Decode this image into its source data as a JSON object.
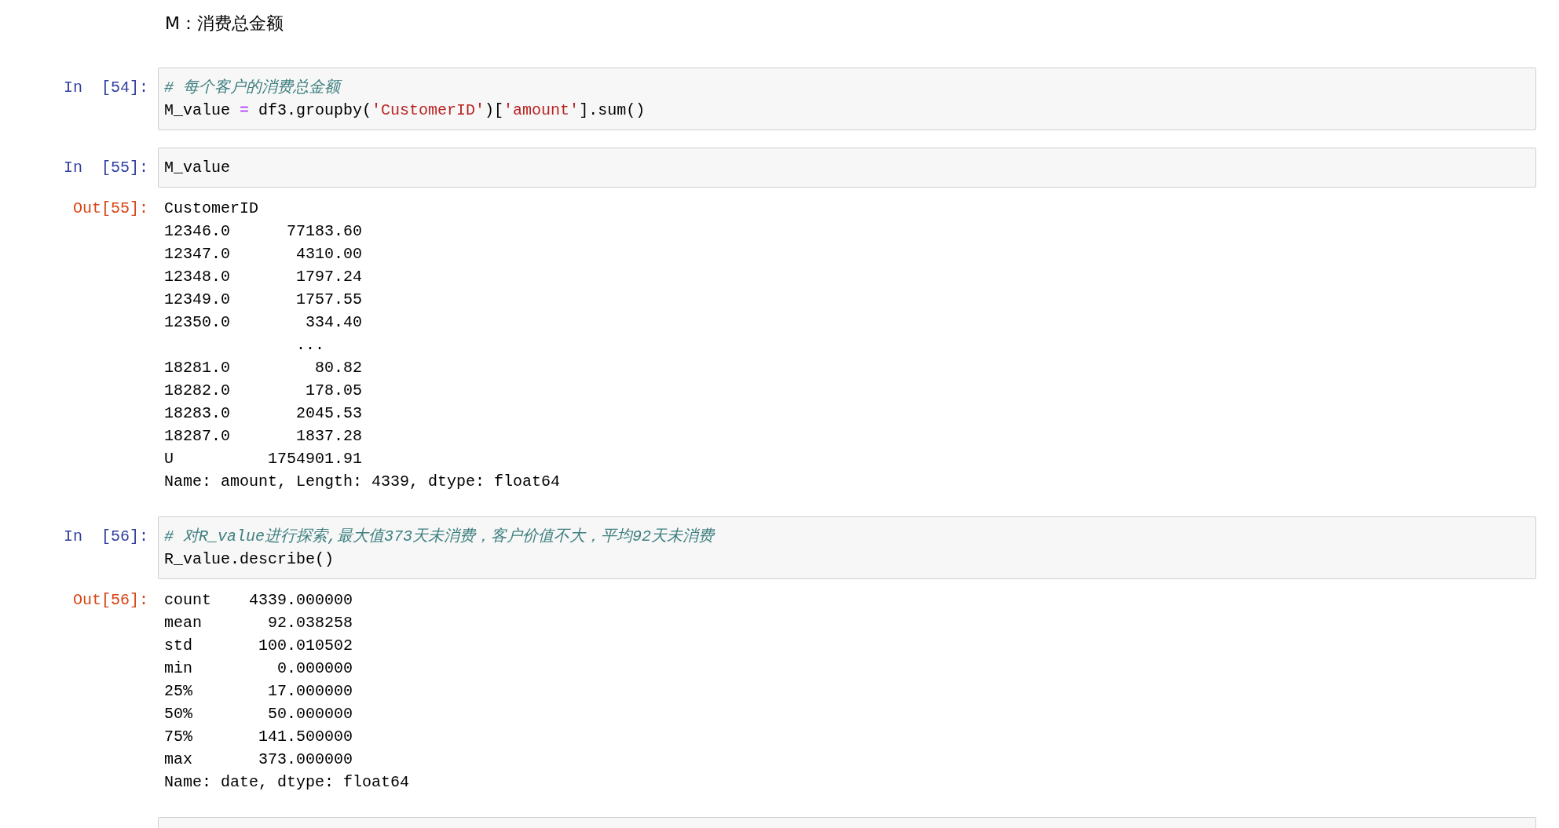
{
  "cells": [
    {
      "kind": "markdown",
      "text": "M：消费总金额"
    },
    {
      "kind": "code",
      "prompt": "In  [54]:",
      "source": [
        [
          {
            "kind": "comment",
            "text": "# 每个客户的消费总金额"
          }
        ],
        [
          {
            "kind": "plain",
            "text": "M_value "
          },
          {
            "kind": "operator",
            "text": "="
          },
          {
            "kind": "plain",
            "text": " df3.groupby("
          },
          {
            "kind": "string",
            "text": "'CustomerID'"
          },
          {
            "kind": "plain",
            "text": ")["
          },
          {
            "kind": "string",
            "text": "'amount'"
          },
          {
            "kind": "plain",
            "text": "].sum()"
          }
        ]
      ]
    },
    {
      "kind": "code",
      "prompt": "In  [55]:",
      "source": [
        [
          {
            "kind": "plain",
            "text": "M_value"
          }
        ]
      ],
      "output": {
        "prompt": "Out[55]:",
        "lines": [
          "CustomerID",
          "12346.0      77183.60",
          "12347.0       4310.00",
          "12348.0       1797.24",
          "12349.0       1757.55",
          "12350.0        334.40",
          "              ...",
          "18281.0         80.82",
          "18282.0        178.05",
          "18283.0       2045.53",
          "18287.0       1837.28",
          "U          1754901.91",
          "Name: amount, Length: 4339, dtype: float64"
        ]
      }
    },
    {
      "kind": "code",
      "prompt": "In  [56]:",
      "source": [
        [
          {
            "kind": "comment",
            "text": "# 对R_value进行探索,最大值373天未消费，客户价值不大，平均92天未消费"
          }
        ],
        [
          {
            "kind": "plain",
            "text": "R_value.describe()"
          }
        ]
      ],
      "output": {
        "prompt": "Out[56]:",
        "lines": [
          "count    4339.000000",
          "mean       92.038258",
          "std       100.010502",
          "min         0.000000",
          "25%        17.000000",
          "50%        50.000000",
          "75%       141.500000",
          "max       373.000000",
          "Name: date, dtype: float64"
        ]
      }
    },
    {
      "kind": "code"
    }
  ]
}
